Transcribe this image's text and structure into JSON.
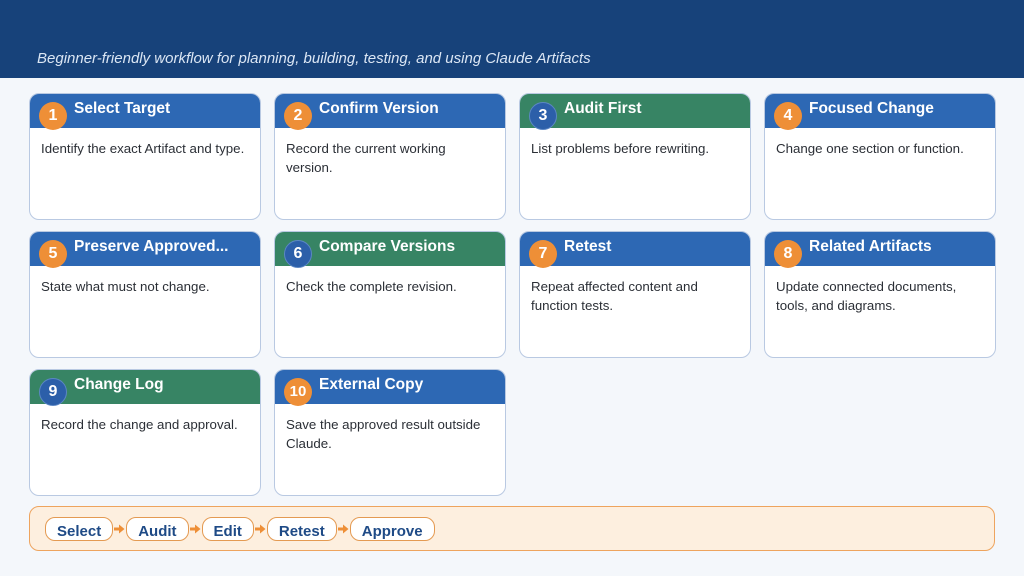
{
  "header": {
    "subtitle": "Beginner-friendly workflow for planning, building, testing, and using Claude Artifacts"
  },
  "steps": [
    {
      "number": "1",
      "title": "Select Target",
      "text": "Identify the exact Artifact and type."
    },
    {
      "number": "2",
      "title": "Confirm Version",
      "text": "Record the current working version."
    },
    {
      "number": "3",
      "title": "Audit First",
      "text": "List problems before rewriting."
    },
    {
      "number": "4",
      "title": "Focused Change",
      "text": "Change one section or function."
    },
    {
      "number": "5",
      "title": "Preserve Approved...",
      "text": "State what must not change."
    },
    {
      "number": "6",
      "title": "Compare Versions",
      "text": "Check the complete revision."
    },
    {
      "number": "7",
      "title": "Retest",
      "text": "Repeat affected content and function tests."
    },
    {
      "number": "8",
      "title": "Related Artifacts",
      "text": "Update connected documents, tools, and diagrams."
    },
    {
      "number": "9",
      "title": "Change Log",
      "text": "Record the change and approval."
    },
    {
      "number": "10",
      "title": "External Copy",
      "text": "Save the approved result outside Claude."
    }
  ],
  "flow": [
    "Select",
    "Audit",
    "Edit",
    "Retest",
    "Approve"
  ],
  "colors": {
    "header": "#17427a",
    "card_blue": "#2d68b4",
    "card_green": "#378464",
    "badge_orange": "#ee8f37",
    "badge_navy": "#2c5fa9"
  }
}
